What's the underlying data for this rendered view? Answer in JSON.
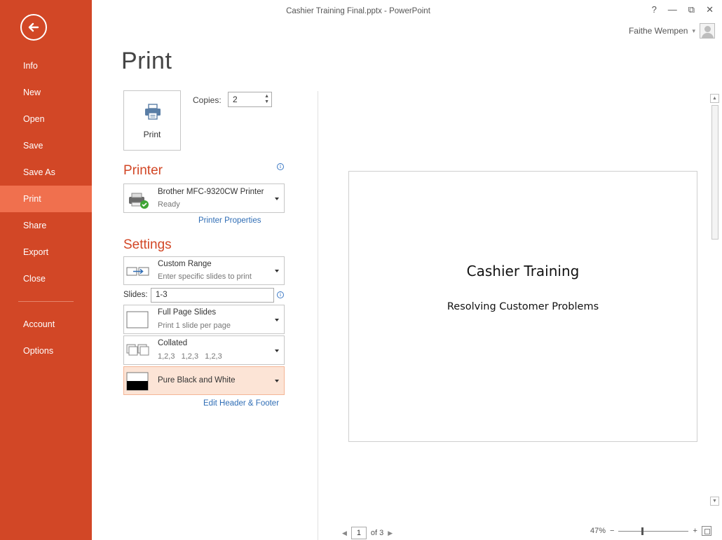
{
  "window": {
    "title": "Cashier Training Final.pptx - PowerPoint",
    "controls": {
      "help": "?",
      "minimize": "—",
      "restore": "⧉",
      "close": "✕"
    },
    "account_name": "Faithe Wempen",
    "account_caret": "▾"
  },
  "sidebar": {
    "items": [
      {
        "label": "Info"
      },
      {
        "label": "New"
      },
      {
        "label": "Open"
      },
      {
        "label": "Save"
      },
      {
        "label": "Save As"
      },
      {
        "label": "Print",
        "active": true
      },
      {
        "label": "Share"
      },
      {
        "label": "Export"
      },
      {
        "label": "Close"
      },
      {
        "label": "Account"
      },
      {
        "label": "Options"
      }
    ]
  },
  "page": {
    "title": "Print"
  },
  "print": {
    "button_label": "Print",
    "copies_label": "Copies:",
    "copies_value": "2"
  },
  "printer": {
    "heading": "Printer",
    "name": "Brother MFC-9320CW Printer",
    "status": "Ready",
    "properties_link": "Printer Properties"
  },
  "settings": {
    "heading": "Settings",
    "range": {
      "title": "Custom Range",
      "desc": "Enter specific slides to print"
    },
    "slides_label": "Slides:",
    "slides_value": "1-3",
    "layout": {
      "title": "Full Page Slides",
      "desc": "Print 1 slide per page"
    },
    "collation": {
      "title": "Collated",
      "desc": "1,2,3   1,2,3   1,2,3"
    },
    "color": {
      "title": "Pure Black and White"
    },
    "header_footer_link": "Edit Header & Footer"
  },
  "preview": {
    "slide_title": "Cashier Training",
    "slide_subtitle": "Resolving Customer Problems",
    "page_current": "1",
    "page_of": "of 3",
    "zoom": "47%",
    "zoom_minus": "−",
    "zoom_plus": "+"
  },
  "colors": {
    "sidebar": "#d24726",
    "sidebar_active": "#f0704e",
    "accent": "#d24726",
    "link": "#2f6db5",
    "highlight": "#fce4d6"
  }
}
